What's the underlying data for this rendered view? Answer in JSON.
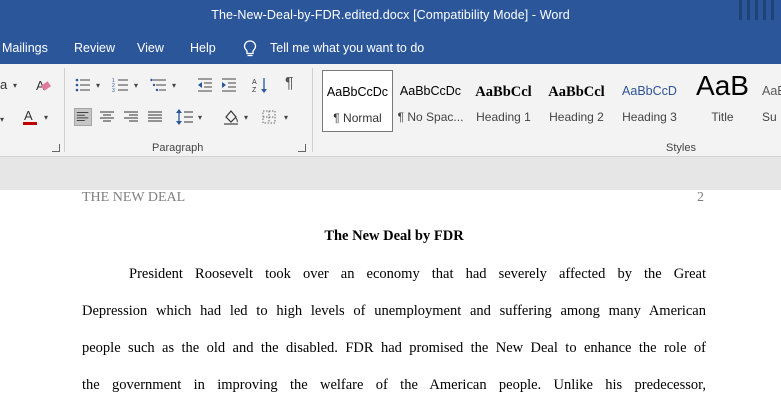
{
  "window": {
    "title": "The-New-Deal-by-FDR.edited.docx [Compatibility Mode]  -  Word"
  },
  "menu": {
    "items": [
      "Mailings",
      "Review",
      "View",
      "Help"
    ],
    "tell_me": "Tell me what you want to do"
  },
  "ribbon": {
    "paragraph_label": "Paragraph",
    "styles_label": "Styles",
    "font_partial": "a",
    "styles": [
      {
        "sample": "AaBbCcDc",
        "name": "¶ Normal"
      },
      {
        "sample": "AaBbCcDc",
        "name": "¶ No Spac..."
      },
      {
        "sample": "AaBbCcl",
        "name": "Heading 1"
      },
      {
        "sample": "AaBbCcl",
        "name": "Heading 2"
      },
      {
        "sample": "AaBbCcD",
        "name": "Heading 3"
      },
      {
        "sample": "AaB",
        "name": "Title"
      },
      {
        "sample": "AaB",
        "name": "Su"
      }
    ],
    "colors": {
      "accent": "#2b579a",
      "font_color": "#c00000",
      "heading3": "#2f5496"
    }
  },
  "document": {
    "header_left": "THE NEW DEAL",
    "header_right": "2",
    "title": "The New Deal by FDR",
    "lines": [
      "President Roosevelt took over an economy that had severely affected by the Great",
      "Depression which had led to high levels of unemployment and suffering among many American",
      "people such as the old and the disabled. FDR had promised the New Deal to enhance the role of",
      "the government in improving the welfare of the American people.  Unlike his predecessor,"
    ]
  }
}
